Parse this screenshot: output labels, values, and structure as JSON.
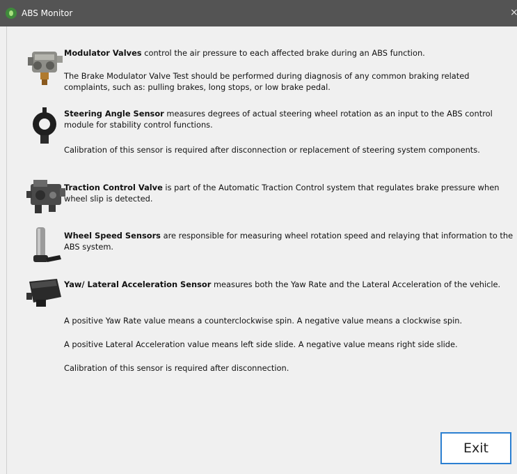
{
  "window": {
    "title": "ABS Monitor",
    "close_glyph": "×"
  },
  "items": [
    {
      "heading": "Modulator Valves",
      "rest": " control the air pressure to each affected brake during an ABS function.",
      "paragraphs": [
        "The Brake Modulator Valve Test should be performed during diagnosis of any common braking related complaints, such as: pulling brakes, long stops, or low brake pedal."
      ]
    },
    {
      "heading": "Steering Angle Sensor",
      "rest": " measures degrees of actual steering wheel rotation as an input to the ABS control module for stability control functions.",
      "paragraphs": [
        "Calibration of this sensor is required after disconnection or replacement of steering system components."
      ]
    },
    {
      "heading": "Traction Control Valve",
      "rest": " is part of the Automatic Traction Control system that regulates brake pressure when wheel slip is detected.",
      "paragraphs": []
    },
    {
      "heading": "Wheel Speed Sensors",
      "rest": " are responsible for measuring wheel rotation speed and relaying that information to the ABS system.",
      "paragraphs": []
    },
    {
      "heading": "Yaw/ Lateral Acceleration Sensor",
      "rest": " measures both the Yaw Rate and the Lateral Acceleration of the vehicle.",
      "paragraphs": [
        "A positive Yaw Rate value means a counterclockwise spin. A negative value means a clockwise spin.",
        "A positive Lateral Acceleration value means left side slide. A negative value means right side slide.",
        "Calibration of this sensor is required after disconnection."
      ]
    }
  ],
  "buttons": {
    "exit_label": "Exit"
  },
  "icons": [
    "modulator-valve-icon",
    "steering-angle-sensor-icon",
    "traction-control-valve-icon",
    "wheel-speed-sensor-icon",
    "yaw-sensor-icon"
  ],
  "colors": {
    "titlebar": "#545454",
    "button_border": "#2b7fd1",
    "background": "#f0f0f0"
  }
}
